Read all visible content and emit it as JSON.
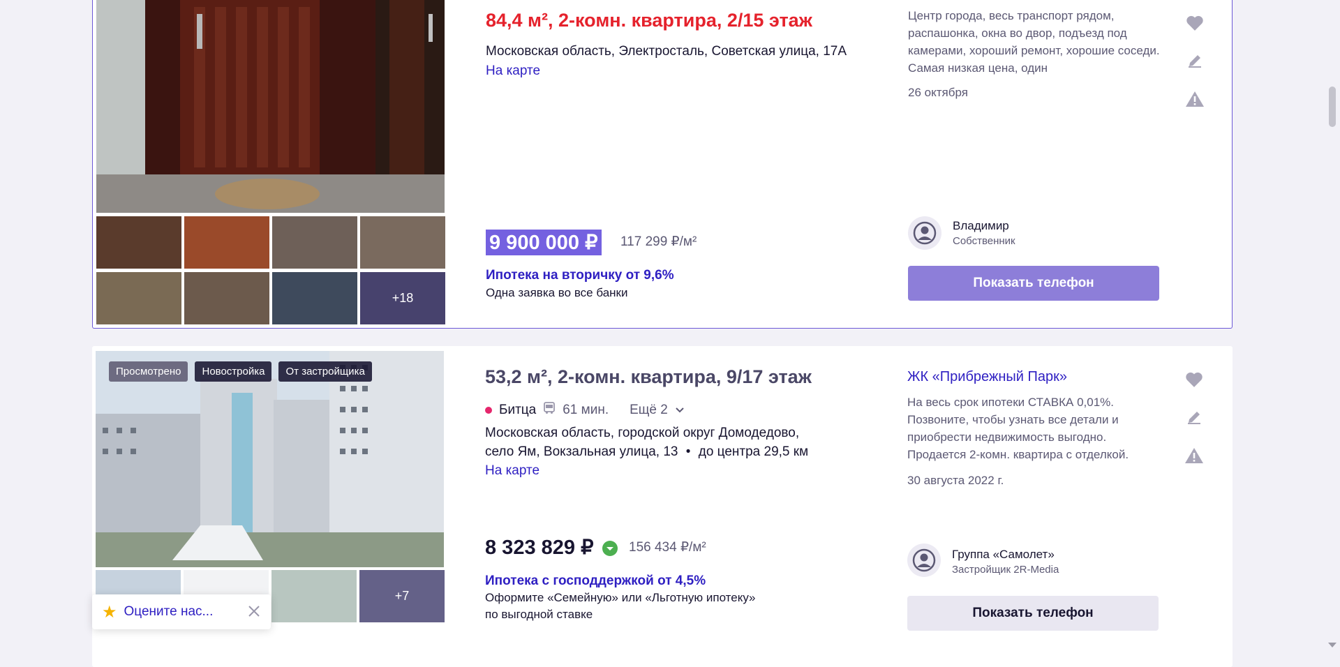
{
  "listing1": {
    "title": "84,4 м², 2-комн. квартира, 2/15 этаж",
    "address": "Московская область, Электросталь, Советская улица, 17А",
    "map_link": "На карте",
    "price": "9 900 000 ₽",
    "price_per_m2": "117 299 ₽/м²",
    "mortgage": "Ипотека на вторичку от 9,6%",
    "mortgage_sub": "Одна заявка во все банки",
    "description": "Центр города, весь транспорт рядом, распашонка, окна во двор, подъезд под камерами, хороший ремонт, хорошие соседи. Самая низкая цена, один",
    "date": "26 октября",
    "seller_name": "Владимир",
    "seller_role": "Собственник",
    "phone_button": "Показать телефон",
    "more_photos": "+18"
  },
  "listing2": {
    "badges": [
      "Просмотрено",
      "Новостройка",
      "От застройщика"
    ],
    "title": "53,2 м², 2-комн. квартира, 9/17 этаж",
    "metro_station": "Битца",
    "metro_time": "61 мин.",
    "metro_more": "Ещё 2",
    "address_line1": "Московская область, городской округ Домодедово,",
    "address_line2": "село Ям, Вокзальная улица, 13",
    "distance": "до центра 29,5 км",
    "map_link": "На карте",
    "price": "8 323 829 ₽",
    "price_per_m2": "156 434 ₽/м²",
    "mortgage": "Ипотека с господдержкой от 4,5%",
    "mortgage_sub_line1": "Оформите «Семейную» или «Льготную ипотеку»",
    "mortgage_sub_line2": "по выгодной ставке",
    "complex_link": "ЖК «Прибрежный Парк»",
    "description": "На весь срок ипотеки СТАВКА 0,01%. Позвоните, чтобы узнать все детали и приобрести недвижимость выгодно. Продается 2-комн. квартира с отделкой.",
    "date": "30 августа 2022 г.",
    "seller_name": "Группа «Самолет»",
    "seller_role": "Застройщик 2R-Media",
    "phone_button": "Показать телефон",
    "more_photos": "+7"
  },
  "rate_widget": {
    "text": "Оцените нас..."
  },
  "icons": {
    "favorite": "heart-icon",
    "note": "pencil-icon",
    "complaint": "warning-icon",
    "avatar": "user-circle-icon",
    "close": "close-icon",
    "star": "star-icon",
    "bus": "bus-icon",
    "chevron": "chevron-down-icon",
    "verified": "check-badge-icon"
  },
  "colors": {
    "accent": "#2e1fc2",
    "price_highlight": "#7461e0",
    "title_red": "#e5222c",
    "button_primary": "#8d7ed9",
    "metro_dot": "#e5266c"
  }
}
